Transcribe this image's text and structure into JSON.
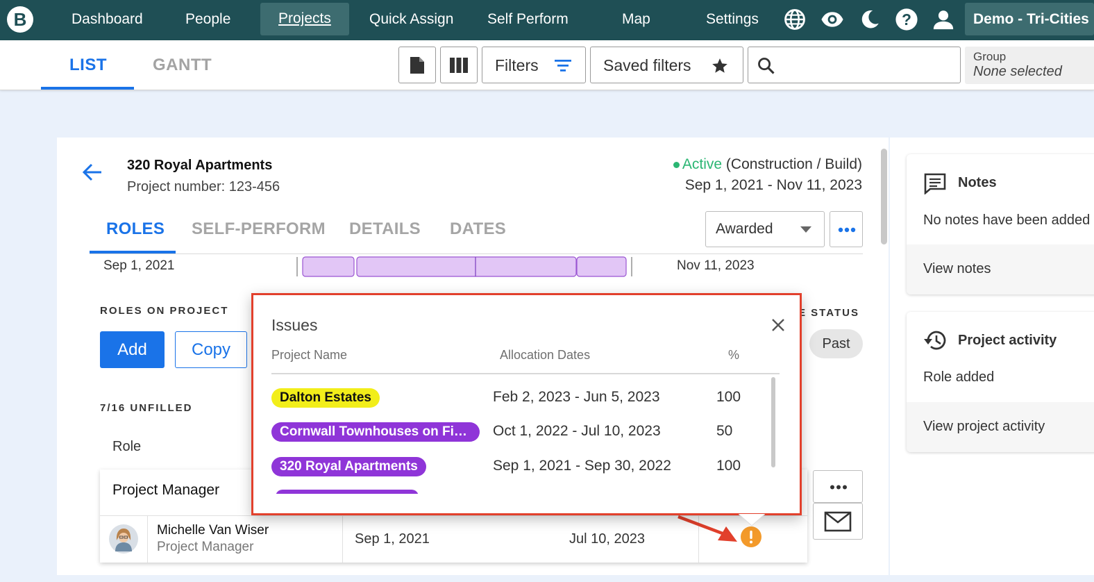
{
  "nav": {
    "logo": "B",
    "items": [
      "Dashboard",
      "People",
      "Projects",
      "Quick Assign",
      "Self Perform",
      "Map",
      "Settings"
    ],
    "account": "Demo - Tri-Cities"
  },
  "toolbar": {
    "tab_list": "LIST",
    "tab_gantt": "GANTT",
    "filters_label": "Filters",
    "saved_filters_label": "Saved filters",
    "search_placeholder": "",
    "group_label": "Group",
    "group_value": "None selected"
  },
  "project": {
    "name": "320 Royal Apartments",
    "number": "Project number: 123-456",
    "status": "Active",
    "status_detail": "(Construction / Build)",
    "date_range": "Sep 1, 2021 - Nov 11, 2023",
    "award_select": "Awarded",
    "tabs": [
      "ROLES",
      "SELF-PERFORM",
      "DETAILS",
      "DATES"
    ],
    "timeline_start": "Sep 1, 2021",
    "timeline_end": "Nov 11, 2023",
    "roles_on_project": "ROLES ON PROJECT",
    "add_label": "Add",
    "copy_label": "Copy",
    "unfilled": "7/16 UNFILLED",
    "role_col": "Role",
    "status_col_partial": "E STATUS",
    "past_chip": "Past",
    "role_name": "Project Manager",
    "person_name": "Michelle Van Wiser",
    "person_role": "Project Manager",
    "alloc_start": "Sep 1, 2021",
    "alloc_end": "Jul 10, 2023"
  },
  "issues": {
    "title": "Issues",
    "columns": [
      "Project Name",
      "Allocation Dates",
      "%"
    ],
    "rows": [
      {
        "name": "Dalton Estates",
        "dates": "Feb 2, 2023 - Jun 5, 2023",
        "pct": "100",
        "color": "#f2ee1a",
        "text": "#111111"
      },
      {
        "name": "Cornwall Townhouses on First…",
        "dates": "Oct 1, 2022 - Jul 10, 2023",
        "pct": "50",
        "color": "#8f35d8",
        "text": "#ffffff"
      },
      {
        "name": "320 Royal Apartments",
        "dates": "Sep 1, 2021 - Sep 30, 2022",
        "pct": "100",
        "color": "#8f35d8",
        "text": "#ffffff"
      }
    ]
  },
  "notes": {
    "title": "Notes",
    "empty": "No notes have been added",
    "view": "View notes"
  },
  "activity": {
    "title": "Project activity",
    "latest": "Role added",
    "view": "View project activity"
  },
  "colors": {
    "nav_bg": "#1f4f55",
    "accent_blue": "#1a73e8",
    "active_green": "#2bb673",
    "warning_orange": "#f39a2b",
    "highlight_red": "#e2402c"
  }
}
